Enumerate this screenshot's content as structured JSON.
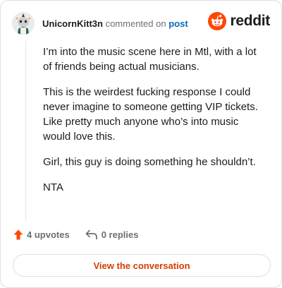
{
  "header": {
    "username": "UnicornKitt3n",
    "action_text": "commented on",
    "post_link": "post",
    "brand_name": "reddit"
  },
  "comment": {
    "paragraphs": [
      "I’m into the music scene here in Mtl, with a lot of friends being actual musicians.",
      "This is the weirdest fucking response I could never imagine to someone getting VIP tickets. Like pretty much anyone who’s into music would love this.",
      "Girl, this guy is doing something he shouldn’t.",
      "NTA"
    ]
  },
  "actions": {
    "upvotes_label": "4 upvotes",
    "replies_label": "0 replies"
  },
  "footer": {
    "view_button_label": "View the conversation"
  },
  "icons": {
    "avatar": "avatar-icon",
    "brand": "reddit-logo-icon",
    "upvote": "upvote-arrow-icon",
    "reply": "reply-arrow-icon"
  },
  "colors": {
    "brand_orange": "#ff4500",
    "upvote_orange": "#ff4500",
    "link_blue": "#0a66c2",
    "button_text": "#d93a00",
    "muted_text": "#6b6f73",
    "border": "#dcdfe3"
  }
}
